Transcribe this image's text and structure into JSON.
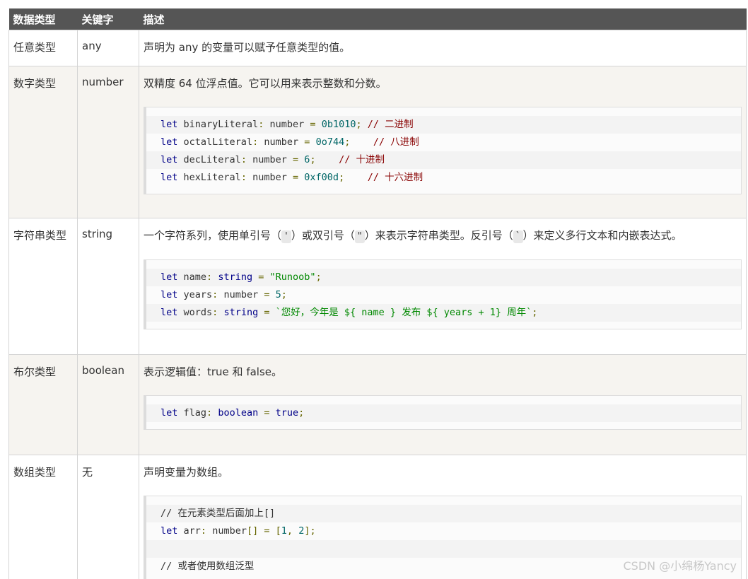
{
  "table": {
    "headers": [
      "数据类型",
      "关键字",
      "描述"
    ],
    "rows": [
      {
        "type_name": "任意类型",
        "keyword": "any",
        "description": "声明为 any 的变量可以赋予任意类型的值。"
      },
      {
        "type_name": "数字类型",
        "keyword": "number",
        "description": "双精度 64 位浮点值。它可以用来表示整数和分数。",
        "code": [
          {
            "kw": "let",
            "name": "binaryLiteral",
            "ty": "number",
            "val": "0b1010",
            "sep": ";",
            "comment": "// 二进制"
          },
          {
            "kw": "let",
            "name": "octalLiteral",
            "ty": "number",
            "val": "0o744",
            "sep": ";",
            "comment": "// 八进制"
          },
          {
            "kw": "let",
            "name": "decLiteral",
            "ty": "number",
            "val": "6",
            "sep": ";",
            "comment": "// 十进制"
          },
          {
            "kw": "let",
            "name": "hexLiteral",
            "ty": "number",
            "val": "0xf00d",
            "sep": ";",
            "comment": "// 十六进制"
          }
        ]
      },
      {
        "type_name": "字符串类型",
        "keyword": "string",
        "description_parts": [
          "一个字符系列，使用单引号（",
          "'",
          "）或双引号（",
          "\"",
          "）来表示字符串类型。反引号（",
          "`",
          "）来定义多行文本和内嵌表达式。"
        ],
        "code": [
          {
            "kw": "let",
            "name": "name",
            "ty": "string",
            "val": "\"Runoob\"",
            "sep": ";"
          },
          {
            "kw": "let",
            "name": "years",
            "ty": "number",
            "val": "5",
            "sep": ";"
          },
          {
            "kw": "let",
            "name": "words",
            "ty": "string",
            "val": "`您好，今年是 ${ name } 发布 ${ years + 1} 周年`",
            "sep": ";"
          }
        ]
      },
      {
        "type_name": "布尔类型",
        "keyword": "boolean",
        "description": "表示逻辑值：true 和 false。",
        "code": [
          {
            "kw": "let",
            "name": "flag",
            "ty": "boolean",
            "val": "true",
            "sep": ";"
          }
        ]
      },
      {
        "type_name": "数组类型",
        "keyword": "无",
        "description": "声明变量为数组。",
        "code_lines": [
          "// 在元素类型后面加上[]",
          "let arr: number[] = [1, 2];",
          "",
          "// 或者使用数组泛型"
        ]
      }
    ]
  },
  "watermark": "CSDN @小绵杨Yancy"
}
